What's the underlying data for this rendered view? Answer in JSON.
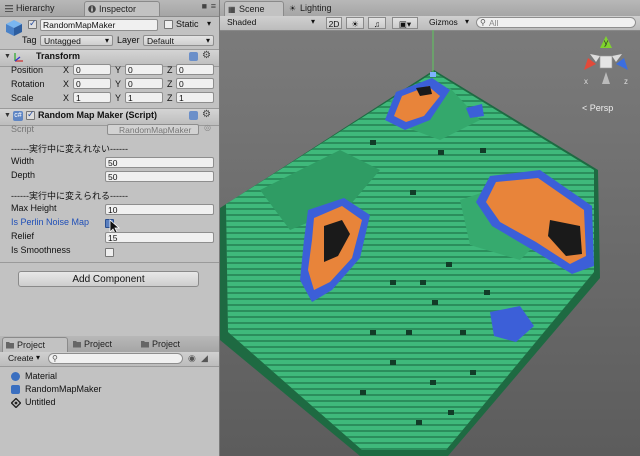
{
  "left_tabs": {
    "hierarchy": "Hierarchy",
    "inspector": "Inspector"
  },
  "object": {
    "name": "RandomMapMaker",
    "static_label": "Static",
    "tag_label": "Tag",
    "tag_value": "Untagged",
    "layer_label": "Layer",
    "layer_value": "Default"
  },
  "transform": {
    "title": "Transform",
    "rows": [
      {
        "label": "Position",
        "x": "0",
        "y": "0",
        "z": "0"
      },
      {
        "label": "Rotation",
        "x": "0",
        "y": "0",
        "z": "0"
      },
      {
        "label": "Scale",
        "x": "1",
        "y": "1",
        "z": "1"
      }
    ],
    "axis": {
      "x": "X",
      "y": "Y",
      "z": "Z"
    }
  },
  "script_component": {
    "title": "Random Map Maker (Script)",
    "script_label": "Script",
    "script_value": "RandomMapMaker",
    "section1": "------実行中に変えれない------",
    "width_label": "Width",
    "width_value": "50",
    "depth_label": "Depth",
    "depth_value": "50",
    "section2": "------実行中に変えられる------",
    "max_height_label": "Max Height",
    "max_height_value": "10",
    "perlin_label": "Is Perlin Noise Map",
    "relief_label": "Relief",
    "relief_value": "15",
    "smooth_label": "Is Smoothness"
  },
  "add_component": "Add Component",
  "project": {
    "tabs": [
      "Project",
      "Project",
      "Project"
    ],
    "create_label": "Create",
    "items": [
      {
        "name": "Material",
        "color": "#3a6fc0"
      },
      {
        "name": "RandomMapMaker",
        "color": "#3a6fc0"
      },
      {
        "name": "Untitled",
        "color": "#222222"
      }
    ]
  },
  "scene": {
    "tabs": [
      "Scene",
      "Lighting"
    ],
    "shading": "Shaded",
    "mode_2d": "2D",
    "gizmos": "Gizmos",
    "search_placeholder": "All",
    "persp_label": "< Persp",
    "gizmo_axes": {
      "x": "x",
      "y": "y",
      "z": "z"
    }
  },
  "colors": {
    "grass": "#3fb97b",
    "grass_dark": "#2a8a58",
    "sand": "#e8843a",
    "water": "#3c5fd8",
    "pit": "#1a1a1a"
  }
}
